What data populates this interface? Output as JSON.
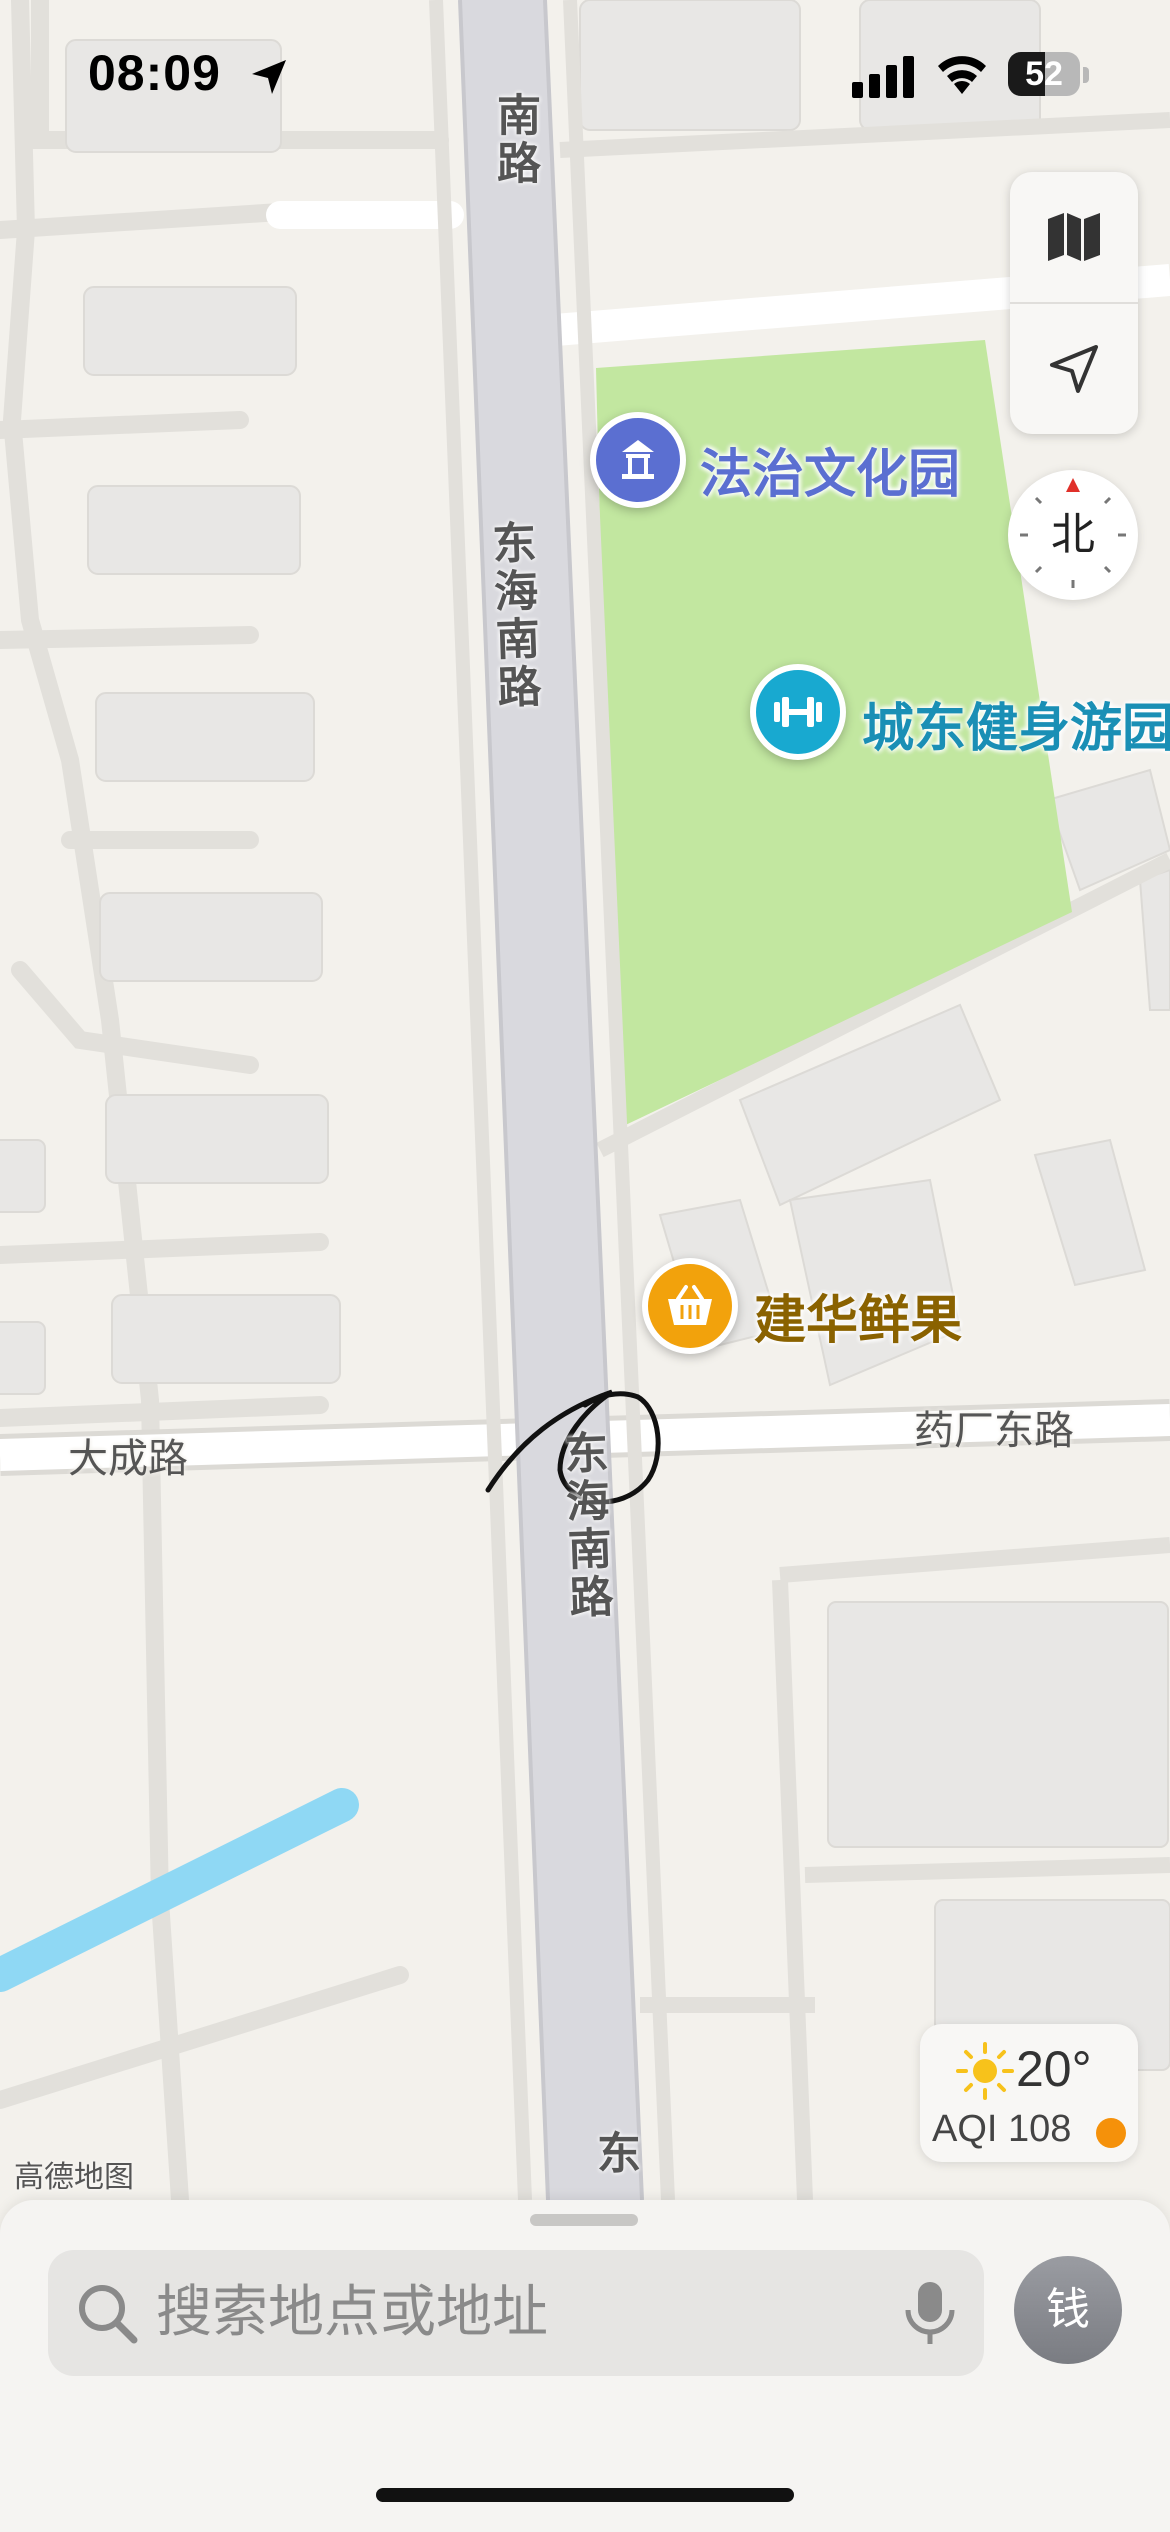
{
  "status_bar": {
    "time": "08:09",
    "battery_level": "52"
  },
  "map_controls": {
    "map_mode_icon": "map-icon",
    "locate_icon": "location-arrow-icon",
    "compass_label": "北"
  },
  "pois": {
    "park": {
      "label": "法治文化园",
      "icon": "pavilion-icon",
      "color": "#5B6FD1"
    },
    "gym": {
      "label": "城东健身游园",
      "icon": "dumbbell-icon",
      "color": "#18A9D0"
    },
    "fruit": {
      "label": "建华鲜果",
      "icon": "basket-icon",
      "color": "#F2A20C"
    }
  },
  "roads": {
    "main_top": "南路",
    "main_mid": "东海南路",
    "main_lower": "东海南路",
    "main_bottom": "东",
    "west_street": "大成路",
    "east_street": "药厂东路"
  },
  "attribution": "高德地图",
  "weather": {
    "temperature": "20°",
    "aqi": "AQI 108",
    "aqi_color": "#F5910A",
    "icon": "sun-icon"
  },
  "search": {
    "placeholder": "搜索地点或地址",
    "search_icon": "search-icon",
    "mic_icon": "microphone-icon"
  },
  "avatar": {
    "label": "钱"
  },
  "colors": {
    "land": "#F3F1EC",
    "park": "#C2E7A0",
    "water": "#8FD8F4",
    "main_road": "#D9D9DE",
    "building": "#E6E5E3"
  }
}
